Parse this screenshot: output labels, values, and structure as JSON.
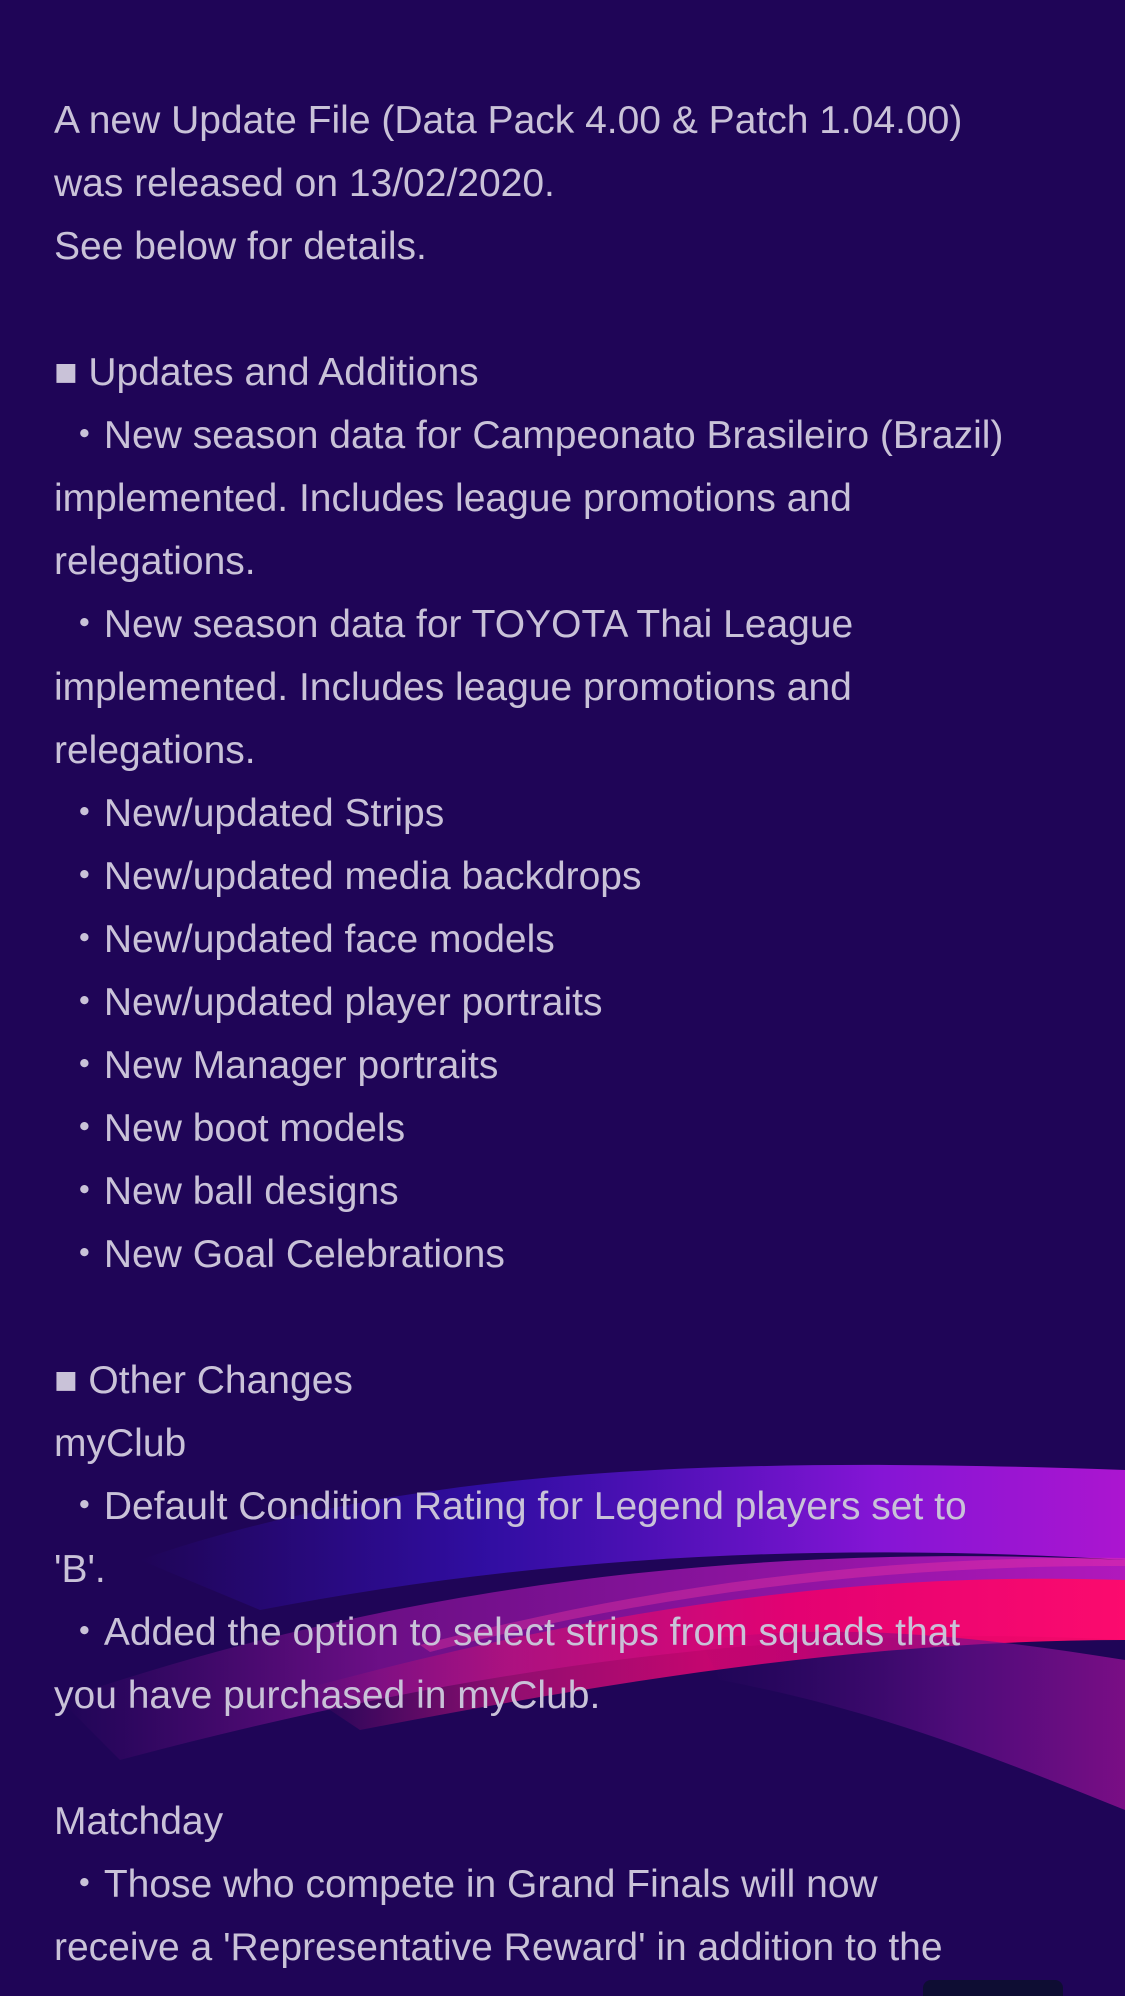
{
  "colors": {
    "background": "#1f0557",
    "text": "#c9c2d8",
    "ribbon_pink": "#e8006f",
    "ribbon_purple": "#9b1ad8",
    "ribbon_blue": "#3a12c9"
  },
  "intro": {
    "line1": "A new Update File (Data Pack 4.00 & Patch 1.04.00)",
    "line2": "was released on 13/02/2020.",
    "line3": "See below for details."
  },
  "updates": {
    "heading": "■ Updates and Additions",
    "items": [
      " ・New season data for Campeonato Brasileiro (Brazil)",
      "implemented. Includes league promotions and",
      "relegations.",
      " ・New season data for TOYOTA Thai League",
      "implemented. Includes league promotions and",
      "relegations.",
      " ・New/updated Strips",
      " ・New/updated media backdrops",
      " ・New/updated face models",
      " ・New/updated player portraits",
      " ・New Manager portraits",
      " ・New boot models",
      " ・New ball designs",
      " ・New Goal Celebrations"
    ]
  },
  "other": {
    "heading": "■ Other Changes",
    "myclub_title": "myClub",
    "myclub_lines": [
      " ・Default Condition Rating for Legend players set to",
      "'B'.",
      " ・Added the option to select strips from squads that",
      "you have purchased in myClub."
    ],
    "matchday_title": "Matchday",
    "matchday_lines": [
      " ・Those who compete in Grand Finals will now",
      "receive a 'Representative Reward' in addition to the"
    ]
  }
}
